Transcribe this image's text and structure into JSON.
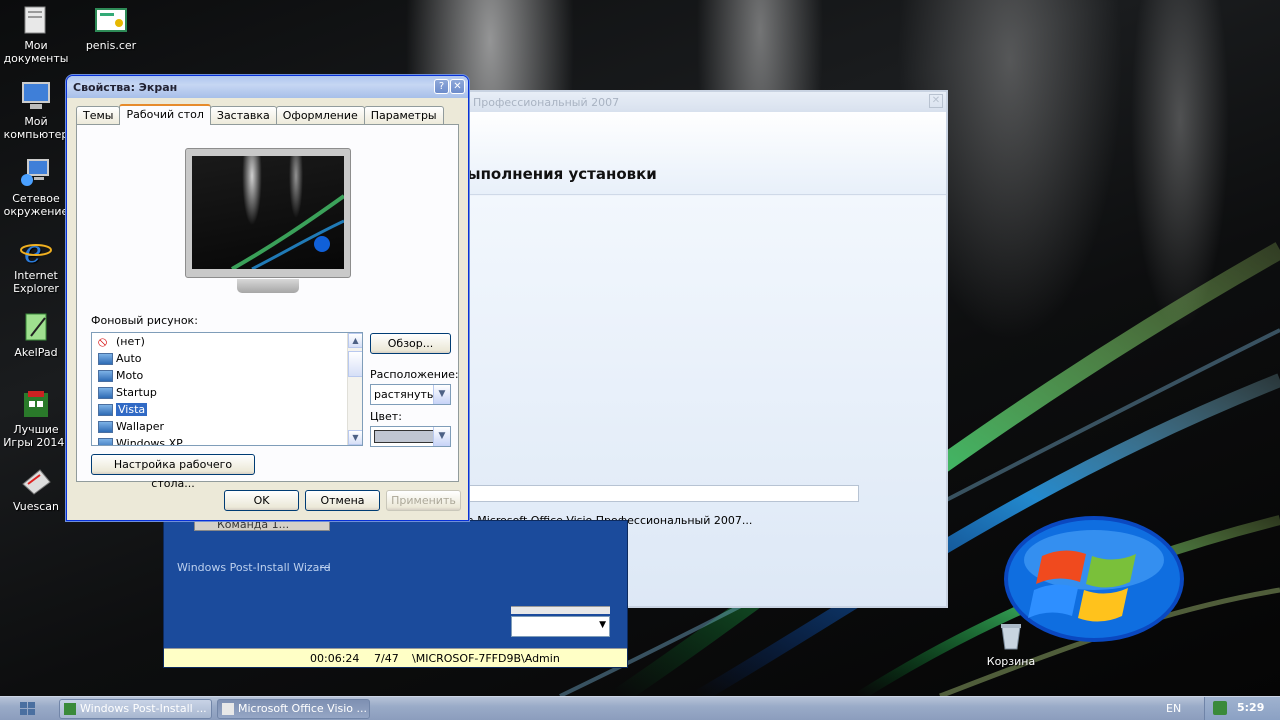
{
  "desktop_icons": [
    {
      "label": "Мои документы",
      "icon": "folder-documents-icon"
    },
    {
      "label": "penis.cer",
      "icon": "certificate-file-icon"
    },
    {
      "label": "Мой компьютер",
      "icon": "my-computer-icon"
    },
    {
      "label": "Сетевое окружение",
      "icon": "network-icon"
    },
    {
      "label": "Internet Explorer",
      "icon": "internet-explorer-icon"
    },
    {
      "label": "AkelPad",
      "icon": "notepad-icon"
    },
    {
      "label": "Лучшие Игры 2014!",
      "icon": "games-icon"
    },
    {
      "label": "Vuescan",
      "icon": "scanner-icon"
    },
    {
      "label": "Корзина",
      "icon": "recycle-bin-icon"
    }
  ],
  "display_properties": {
    "title": "Свойства: Экран",
    "tabs": [
      "Темы",
      "Рабочий стол",
      "Заставка",
      "Оформление",
      "Параметры"
    ],
    "selected_tab": "Рабочий стол",
    "background_label": "Фоновый рисунок:",
    "backgrounds": [
      "(нет)",
      "Auto",
      "Moto",
      "Startup",
      "Vista",
      "Wallaper",
      "Windows XP"
    ],
    "selected_background": "Vista",
    "browse_button": "Обзор...",
    "position_label": "Расположение:",
    "position_value": "растянуть",
    "color_label": "Цвет:",
    "color_value": "#c0c6d2",
    "customize_button": "Настройка рабочего стола...",
    "ok_button": "OK",
    "cancel_button": "Отмена",
    "apply_button": "Применить"
  },
  "install_window": {
    "title": "Профессиональный 2007",
    "heading": "ыполнения установки",
    "status": "а Microsoft Office Visio Профессиональный 2007..."
  },
  "post_install_wizard": {
    "label": "Windows Post-Install Wizard",
    "command_tab": "Команда 1...",
    "status_time": "00:06:24",
    "status_count": "7/47",
    "status_user": "\\MICROSOF-7FFD9B\\Admin"
  },
  "taskbar": {
    "tasks": [
      {
        "label": "Windows Post-Install ...",
        "active": false
      },
      {
        "label": "Microsoft Office Visio ...",
        "active": true
      }
    ],
    "language": "EN",
    "clock": "5:29"
  }
}
